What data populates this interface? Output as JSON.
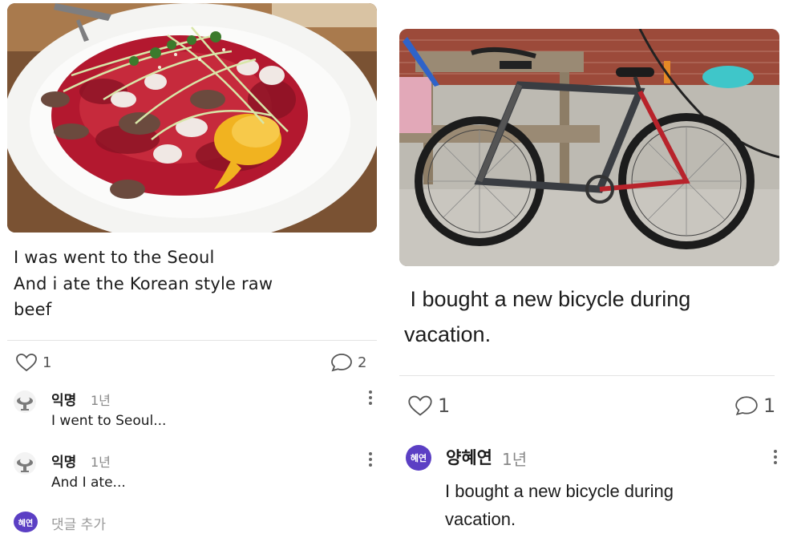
{
  "post_left": {
    "caption_lines": [
      "I was went to the Seoul",
      "And i ate the Korean style raw",
      "beef"
    ],
    "photo_subject": "korean-raw-beef-yukhoe-with-octopus-and-egg-yolk",
    "like_icon": "heart-outline-icon",
    "likes": "1",
    "comment_icon": "speech-bubble-icon",
    "comments": "2",
    "comment_list": [
      {
        "author": "익명",
        "time": "1년",
        "text": "I went to Seoul...",
        "avatar_icon": "anonymous-avatar-icon",
        "menu_icon": "kebab-menu-icon"
      },
      {
        "author": "익명",
        "time": "1년",
        "text": "And I ate...",
        "avatar_icon": "anonymous-avatar-icon",
        "menu_icon": "kebab-menu-icon"
      }
    ],
    "add_comment": {
      "avatar_text": "혜연",
      "placeholder": "댓글 추가"
    }
  },
  "post_right": {
    "caption_lines": [
      " I bought a new bicycle during",
      "vacation."
    ],
    "photo_subject": "mountain-bicycle-in-front-of-picnic-table",
    "like_icon": "heart-outline-icon",
    "likes": "1",
    "comment_icon": "speech-bubble-icon",
    "comments": "1",
    "comment_list": [
      {
        "author": "양혜연",
        "time": "1년",
        "avatar_text": "혜연",
        "text_lines": [
          "I bought a new bicycle during",
          "vacation."
        ],
        "menu_icon": "kebab-menu-icon"
      }
    ]
  },
  "colors": {
    "avatar_purple": "#5b3fc4",
    "text_primary": "#1c1c1c",
    "text_muted": "#888888",
    "divider": "#e3e3e3"
  }
}
